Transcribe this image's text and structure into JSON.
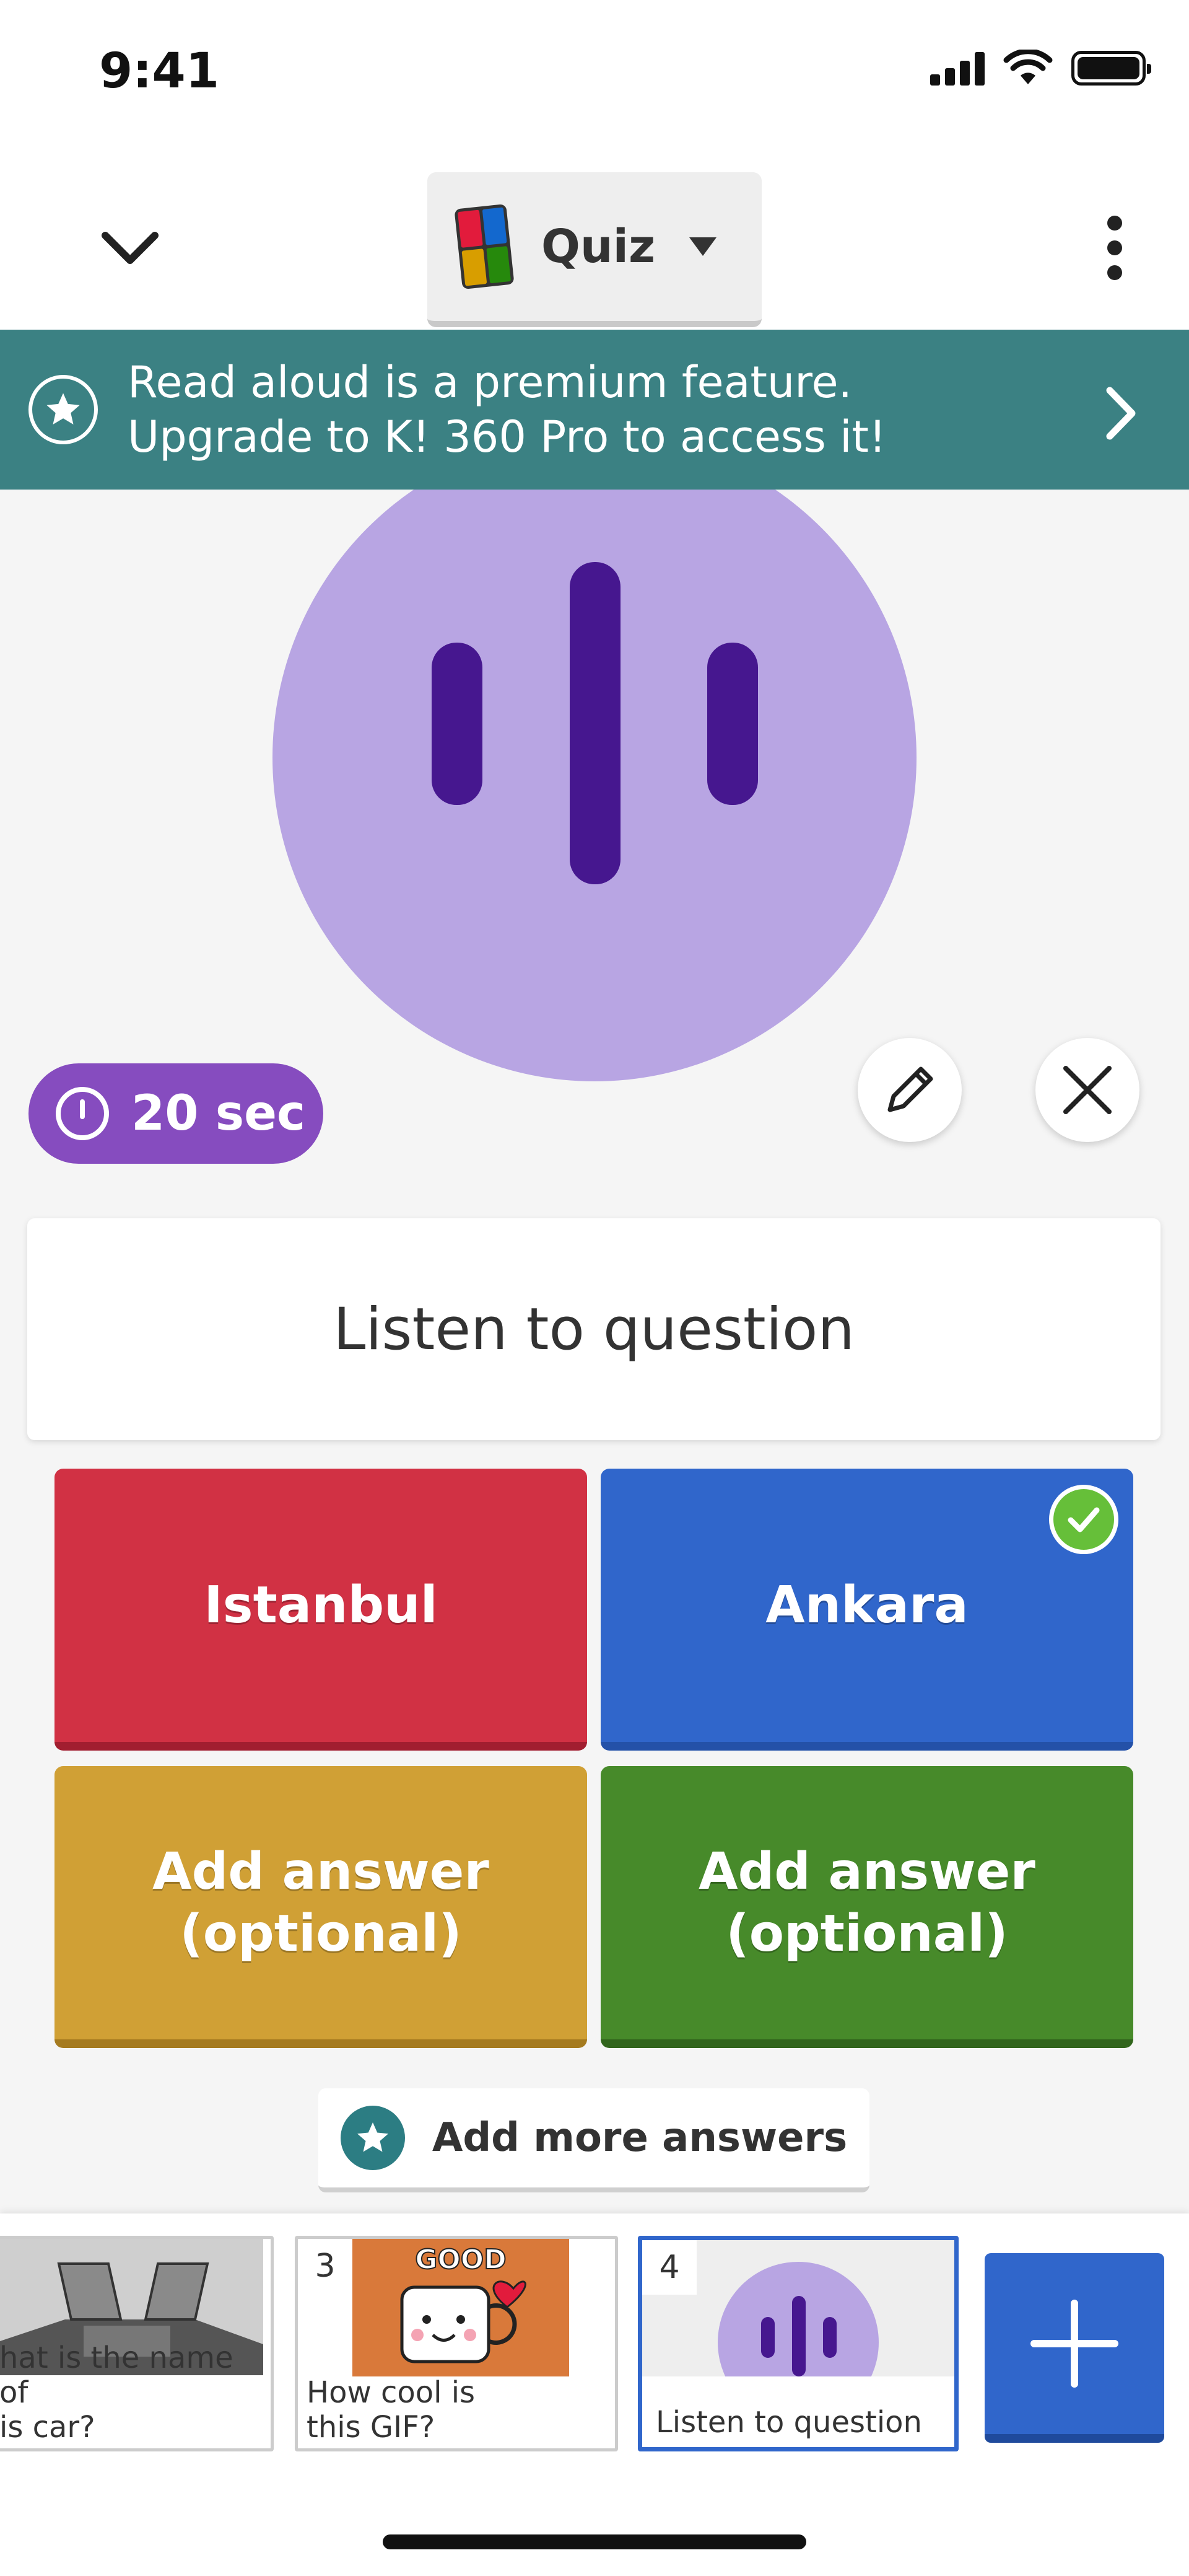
{
  "status_bar": {
    "time": "9:41"
  },
  "app_bar": {
    "quiz_type_label": "Quiz"
  },
  "premium_banner": {
    "line1": "Read aloud is a premium feature.",
    "line2": "Upgrade to K! 360 Pro to access it!"
  },
  "timer": {
    "label": "20 sec"
  },
  "question": {
    "text": "Listen to question"
  },
  "answers": [
    {
      "text": "Istanbul",
      "color": "#d13144",
      "correct": false
    },
    {
      "text": "Ankara",
      "color": "#3066cb",
      "correct": true
    },
    {
      "line1": "Add answer",
      "line2": "(optional)",
      "color": "#d0a035"
    },
    {
      "line1": "Add answer",
      "line2": "(optional)",
      "color": "#478a2a"
    }
  ],
  "add_more_answers": {
    "label": "Add more answers"
  },
  "slides": [
    {
      "number": "",
      "caption_line1": "hat is the name of",
      "caption_line2": "is car?"
    },
    {
      "number": "3",
      "caption_line1": "How cool is",
      "caption_line2": "this GIF?",
      "gif_text": "GOOD"
    },
    {
      "number": "4",
      "caption_line1": "Listen to question",
      "active": true
    }
  ],
  "colors": {
    "accent": "#3066cb",
    "teal": "#3b8183",
    "purple": "#864cbf"
  }
}
